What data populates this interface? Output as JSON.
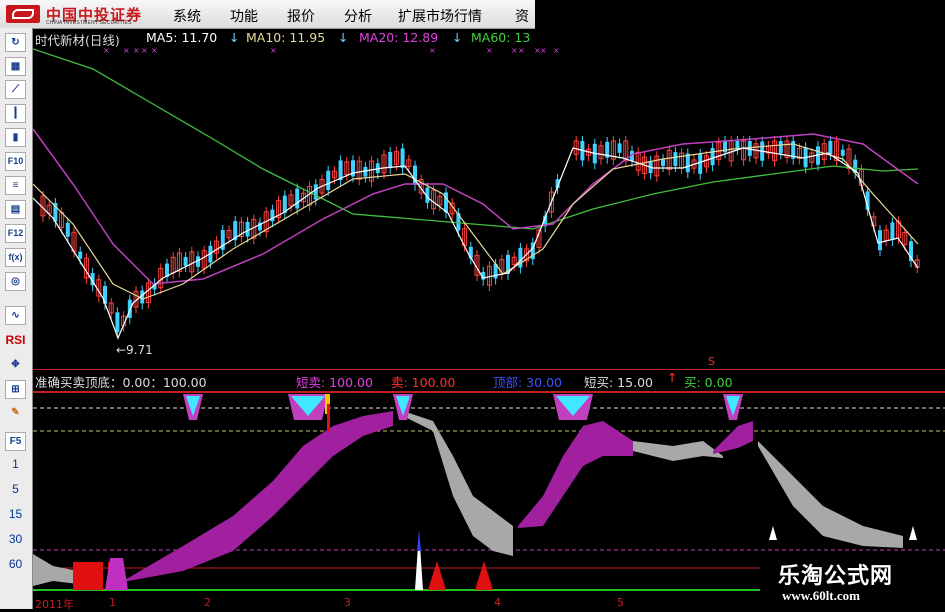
{
  "menubar": {
    "logo_cn": "中国中投证券",
    "logo_en": "CHINA INVESTMENT SECURITIES",
    "items": [
      "系统",
      "功能",
      "报价",
      "分析",
      "扩展市场行情",
      "资"
    ]
  },
  "toolbar": {
    "icons": [
      "refresh-icon",
      "grid-icon",
      "line-chart-icon",
      "candle-icon",
      "kline-icon"
    ],
    "labels": [
      "F10",
      "",
      "F12",
      "f(x)",
      "",
      "",
      "RSI",
      "",
      "",
      "",
      "F5",
      "1",
      "5",
      "15",
      "30",
      "60"
    ]
  },
  "price_header": {
    "name": "时代新材(日线)",
    "ma5": "MA5: 11.70",
    "ma10": "MA10: 11.95",
    "ma20": "MA20: 12.89",
    "ma60": "MA60: 13",
    "arrow": "↓",
    "low_label": "←9.71"
  },
  "indicator_header": {
    "title": "准确买卖顶底：0.00：100.00",
    "short_sell": "短卖: 100.00",
    "sell": "卖: 100.00",
    "peak": "顶部: 30.00",
    "short_buy": "短买: 15.00",
    "buy_arrow": "↑",
    "buy": "买: 0.00",
    "s_mark": "S"
  },
  "axis": {
    "dates": [
      "2011年",
      "1",
      "2",
      "3",
      "4",
      "5"
    ]
  },
  "watermark": {
    "title": "乐淘公式网",
    "url": "www.60lt.com"
  },
  "colors": {
    "ma5": "#ffffff",
    "ma10": "#e8d99a",
    "ma20": "#c040c0",
    "ma60": "#40c040",
    "up": "#ff4040",
    "down": "#40d0ff",
    "magenta_area": "#a020a0",
    "gray_area": "#a8a8a8"
  }
}
